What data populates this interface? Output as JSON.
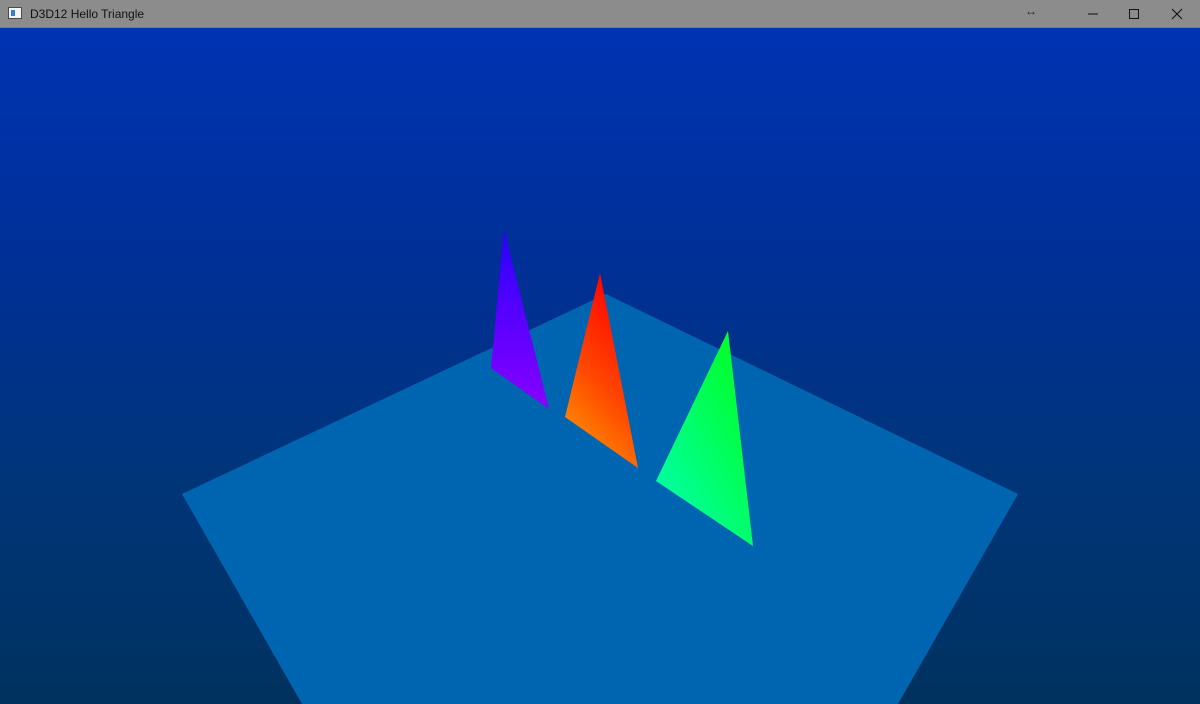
{
  "window": {
    "title": "D3D12 Hello Triangle"
  },
  "titlebar_icons": {
    "app": "app-icon",
    "resize": "resize-arrows-icon",
    "minimize": "minimize-icon",
    "maximize": "maximize-icon",
    "close": "close-icon"
  },
  "scene": {
    "background_top": "#0033b2",
    "background_bottom": "#00325f",
    "floor_color": "#0065b0",
    "triangles": [
      {
        "name": "purple",
        "colors": [
          "#2a00ff",
          "#8800ff"
        ]
      },
      {
        "name": "red-orange",
        "colors": [
          "#ff0000",
          "#ff9a00"
        ]
      },
      {
        "name": "green",
        "colors": [
          "#00ff33",
          "#00ffa0"
        ]
      }
    ]
  }
}
